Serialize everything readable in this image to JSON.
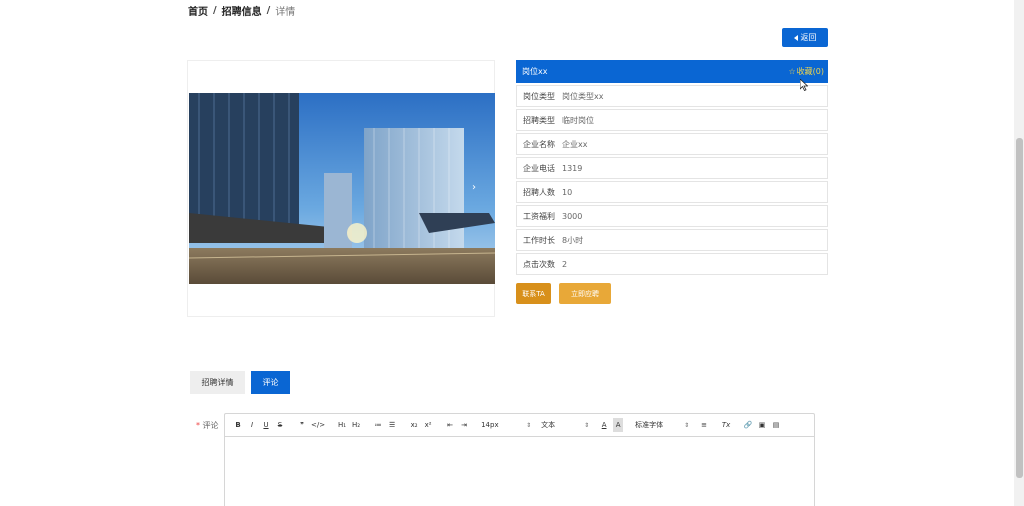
{
  "breadcrumb": {
    "home": "首页",
    "section": "招聘信息",
    "current": "详情",
    "separator": "/"
  },
  "back_button": {
    "label": "返回",
    "icon": "caret-left-icon"
  },
  "job": {
    "title": "岗位xx",
    "favorite_label": "收藏(0)",
    "favorite_icon": "star-outline-icon",
    "fields": [
      {
        "key": "岗位类型",
        "value": "岗位类型xx"
      },
      {
        "key": "招聘类型",
        "value": "临时岗位"
      },
      {
        "key": "企业名称",
        "value": "企业xx"
      },
      {
        "key": "企业电话",
        "value": "1319"
      },
      {
        "key": "招聘人数",
        "value": "10"
      },
      {
        "key": "工资福利",
        "value": "3000"
      },
      {
        "key": "工作时长",
        "value": "8小时"
      },
      {
        "key": "点击次数",
        "value": "2"
      }
    ]
  },
  "actions": {
    "contact": "联系TA",
    "apply": "立即应聘"
  },
  "tabs": [
    {
      "label": "招聘详情",
      "active": false
    },
    {
      "label": "评论",
      "active": true
    }
  ],
  "comment": {
    "label": "评论",
    "required_mark": "*",
    "toolbar": {
      "bold": "B",
      "italic": "I",
      "underline": "U",
      "strike": "S",
      "blockquote": "❞",
      "code": "</>",
      "h1": "H₁",
      "h2": "H₂",
      "ordered_list": "≔",
      "bullet_list": "☰",
      "subscript": "x₂",
      "superscript": "x²",
      "outdent": "⇤",
      "indent": "⇥",
      "size": "14px",
      "format": "文本",
      "font_color": "A",
      "background_color": "A",
      "font_family": "标准字体",
      "align": "≡",
      "clean": "Tx",
      "link": "🔗",
      "image": "▣",
      "video": "▤"
    }
  },
  "colors": {
    "primary": "#0a66d3",
    "favorite": "#f2d64b",
    "contact": "#d8901b",
    "apply": "#e8a838"
  }
}
